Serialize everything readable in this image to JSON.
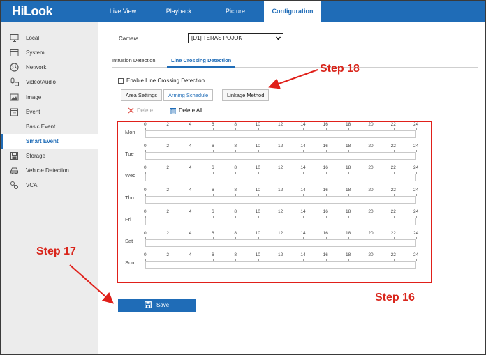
{
  "app": {
    "logo": "HiLook"
  },
  "nav": {
    "items": [
      {
        "label": "Live View"
      },
      {
        "label": "Playback"
      },
      {
        "label": "Picture"
      },
      {
        "label": "Configuration"
      }
    ],
    "active": "Configuration"
  },
  "sidebar": {
    "items": [
      {
        "label": "Local",
        "icon": "monitor-icon"
      },
      {
        "label": "System",
        "icon": "system-icon"
      },
      {
        "label": "Network",
        "icon": "globe-icon"
      },
      {
        "label": "Video/Audio",
        "icon": "video-audio-icon"
      },
      {
        "label": "Image",
        "icon": "image-icon"
      },
      {
        "label": "Event",
        "icon": "calendar-icon"
      },
      {
        "label": "Basic Event",
        "icon": ""
      },
      {
        "label": "Smart Event",
        "icon": ""
      },
      {
        "label": "Storage",
        "icon": "storage-icon"
      },
      {
        "label": "Vehicle Detection",
        "icon": "vehicle-icon"
      },
      {
        "label": "VCA",
        "icon": "vca-icon"
      }
    ],
    "selected": "Smart Event"
  },
  "main": {
    "camera_label": "Camera",
    "camera_value": "[D1] TERAS POJOK",
    "tabs": [
      {
        "label": "Intrusion Detection"
      },
      {
        "label": "Line Crossing Detection"
      }
    ],
    "active_tab": "Line Crossing Detection",
    "enable_label": "Enable Line Crossing Detection",
    "enable_checked": false,
    "subtabs": [
      {
        "label": "Area Settings"
      },
      {
        "label": "Arming Schedule"
      },
      {
        "label": "Linkage Method"
      }
    ],
    "active_subtab": "Arming Schedule",
    "delete_label": "Delete",
    "delete_all_label": "Delete All",
    "save_label": "Save"
  },
  "schedule": {
    "days": [
      "Mon",
      "Tue",
      "Wed",
      "Thu",
      "Fri",
      "Sat",
      "Sun"
    ],
    "hour_ticks": [
      "0",
      "2",
      "4",
      "6",
      "8",
      "10",
      "12",
      "14",
      "16",
      "18",
      "20",
      "22",
      "24"
    ]
  },
  "annotations": {
    "step16": "Step 16",
    "step17": "Step 17",
    "step18": "Step 18"
  },
  "colors": {
    "brand_blue": "#1f6cb7",
    "annotation_red": "#e0201a",
    "sidebar_bg": "#ececec"
  }
}
